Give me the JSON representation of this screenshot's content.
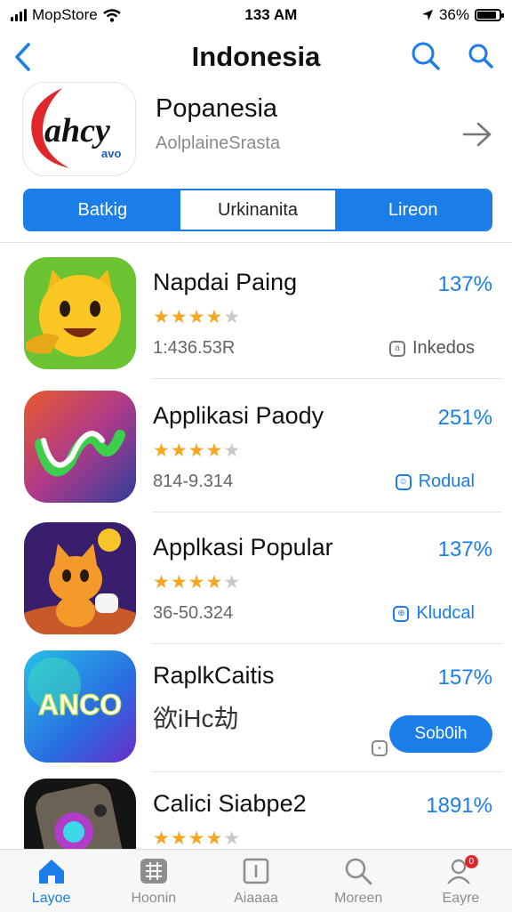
{
  "status": {
    "carrier": "MopStore",
    "time": "133 AM",
    "battery": "36%",
    "battery_level": 0.86
  },
  "nav": {
    "title": "Indonesia",
    "back_icon": "chevron-left-icon",
    "search_icon": "search-icon"
  },
  "header": {
    "name": "Popanesia",
    "subtitle": "AolplaineSrasta",
    "logo_text": "ahcy",
    "logo_subtext": "avo",
    "arrow_icon": "arrow-right-icon"
  },
  "segments": [
    {
      "label": "Batkig",
      "active": true
    },
    {
      "label": "Urkinanita",
      "active": false
    },
    {
      "label": "Lireon",
      "active": true
    }
  ],
  "apps": [
    {
      "name": "Napdai Paing",
      "percent": "137%",
      "rating": 4,
      "meta": "1:436.53R",
      "category": "Inkedos",
      "category_icon": "badge-icon",
      "category_color": "#777777"
    },
    {
      "name": "Applikasi Paody",
      "percent": "251%",
      "rating": 4,
      "meta": "814-9.314",
      "category": "Rodual",
      "category_icon": "badge-icon",
      "category_color": "#1a7de8"
    },
    {
      "name": "Applkasi Popular",
      "percent": "137%",
      "rating": 4,
      "meta": "36-50.324",
      "category": "Kludcal",
      "category_icon": "badge-icon",
      "category_color": "#1a7de8"
    },
    {
      "name": "RaplkCaitis",
      "percent": "157%",
      "subtitle": "欲iHc劫",
      "button": "Sob0ih",
      "icon_text": "ANCO"
    },
    {
      "name": "Calici Siabpe2",
      "percent": "1891%",
      "rating": 4
    }
  ],
  "tabs": [
    {
      "label": "Layoe",
      "icon": "home-icon",
      "active": true
    },
    {
      "label": "Hoonin",
      "icon": "grid-icon",
      "active": false
    },
    {
      "label": "Aiaaaa",
      "icon": "square-icon",
      "active": false
    },
    {
      "label": "Moreen",
      "icon": "search-icon",
      "active": false
    },
    {
      "label": "Eayre",
      "icon": "person-icon",
      "active": false,
      "badge": "0"
    }
  ],
  "colors": {
    "accent": "#1a7de8",
    "star": "#f5a623"
  }
}
